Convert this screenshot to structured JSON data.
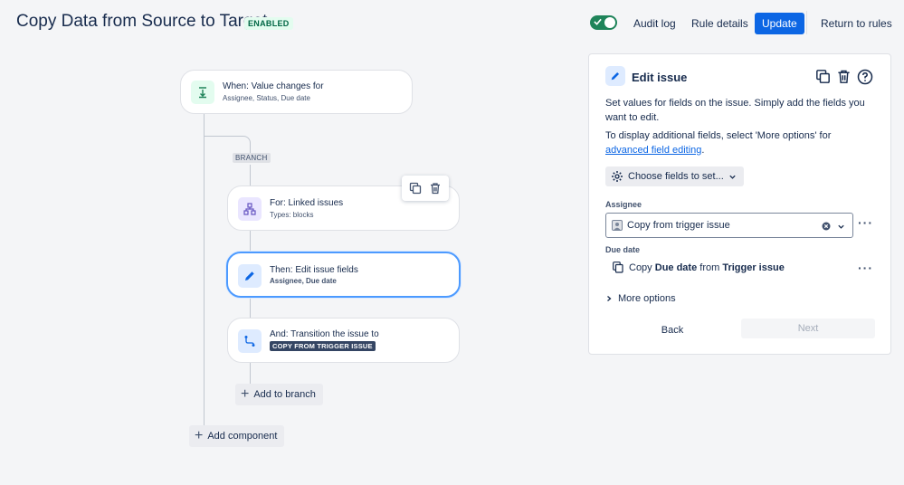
{
  "header": {
    "title": "Copy Data from Source to Target",
    "status_badge": "ENABLED",
    "toggle_state": "on",
    "buttons": {
      "audit_log": "Audit log",
      "rule_details": "Rule details",
      "update": "Update",
      "return": "Return to rules"
    }
  },
  "flow": {
    "trigger": {
      "title": "When: Value changes for",
      "subtitle": "Assignee, Status, Due date",
      "icon": "trigger-icon"
    },
    "branch_label": "BRANCH",
    "branch_item": {
      "title": "For: Linked issues",
      "subtitle": "Types: blocks",
      "icon": "hierarchy-icon"
    },
    "action_edit": {
      "title": "Then: Edit issue fields",
      "subtitle": "Assignee, Due date",
      "icon": "pencil-icon"
    },
    "action_transition": {
      "title": "And: Transition the issue to",
      "lozenge": "COPY FROM TRIGGER ISSUE",
      "icon": "transition-icon"
    },
    "add_to_branch": "Add to branch",
    "add_component": "Add component"
  },
  "panel": {
    "title": "Edit issue",
    "description": "Set values for fields on the issue. Simply add the fields you want to edit.",
    "more_text_prefix": "To display additional fields, select 'More options' for ",
    "more_text_link": "advanced field editing",
    "more_text_suffix": ".",
    "choose_fields": "Choose fields to set...",
    "assignee_label": "Assignee",
    "assignee_value": "Copy from trigger issue",
    "due_date_label": "Due date",
    "due_date_copy": "Copy",
    "due_date_field": "Due date",
    "due_date_from": "from",
    "due_date_source": "Trigger issue",
    "more_options": "More options",
    "back": "Back",
    "next": "Next"
  },
  "colors": {
    "accent": "#0c66e4",
    "toggle": "#1f845a",
    "badge_text": "#006644",
    "selected_border": "#4c9aff"
  }
}
